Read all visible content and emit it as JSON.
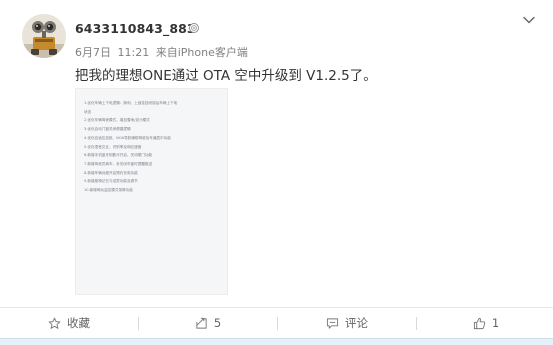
{
  "post": {
    "username": "6433110843_883",
    "meta": {
      "date": "6月7日",
      "time": "11:21",
      "source_prefix": "来自",
      "source": "iPhone客户端"
    },
    "text": "把我的理想ONE通过 OTA 空中升级到 V1.2.5了。"
  },
  "image": {
    "lines": [
      "1.优化车辆上下电逻辑：踩刹、上锁挂挡闭锁后车辆上下电",
      "   状态",
      "2.优化车辆驾驶模式，增加雪地/泥沙模式",
      "3.优化自动门窗关闭便捷逻辑",
      "4.优化自适应巡航、NOA导航辅助驾驶及车道居中功能",
      "5.优化语音交互，识别率及响应速度",
      "6.新增手机蓝牙钥匙可开启、关闭尾门功能",
      "7.新增驾驶员离车，未关闭车窗时提醒推送",
      "8.新增车辆远程开启预约充电功能",
      "9.新增座椅记忆与迎宾功能及调节",
      "10.新增哨兵监控模式录像功能"
    ]
  },
  "actions": {
    "favorite_label": "收藏",
    "repost_label": "5",
    "comment_label": "评论",
    "like_label": "1"
  },
  "colors": {
    "text": "#333333",
    "meta": "#808080",
    "action": "#666666",
    "strip": "#e6f0f7"
  }
}
